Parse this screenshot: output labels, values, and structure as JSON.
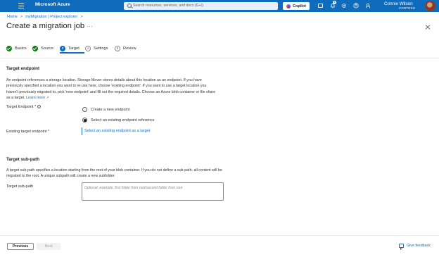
{
  "topbar": {
    "brand": "Microsoft Azure",
    "search_placeholder": "Search resources, services, and docs (G+/)",
    "copilot_label": "Copilot",
    "notification_count": "1",
    "user_name": "Connie Wilson",
    "user_org": "CONTOSO",
    "color": "#0f6cbd"
  },
  "breadcrumb": {
    "items": [
      "Home",
      "myMigration | Project explorer"
    ],
    "separator": ">"
  },
  "page": {
    "title": "Create a migration job",
    "more": "···"
  },
  "steps": [
    {
      "label": "Basics",
      "state": "done",
      "number": "1"
    },
    {
      "label": "Source",
      "state": "done",
      "number": "2"
    },
    {
      "label": "Target",
      "state": "current",
      "number": "3"
    },
    {
      "label": "Settings",
      "state": "todo",
      "number": "4"
    },
    {
      "label": "Review",
      "state": "todo",
      "number": "5"
    }
  ],
  "target_endpoint": {
    "heading": "Target endpoint",
    "description": "An endpoint references a storage location. Storage Mover stores details about this location as an endpoint. If you have previously specified a location you want to re-use here, choose 'existing endpoint'. If you want to use a target location you haven't previously migrated to, pick 'new endpoint' and fill out the required details. Choose an Azure blob container or file share as a target.",
    "learn_more": "Learn more",
    "endpoint_label": "Target Endpoint *",
    "options": [
      {
        "label": "Create a new endpoint",
        "checked": false
      },
      {
        "label": "Select an existing endpoint reference",
        "checked": true
      }
    ],
    "existing_label": "Existing target endpoint *",
    "select_link": "Select an existing endpoint as a target"
  },
  "target_subpath": {
    "heading": "Target sub-path",
    "description": "A target sub-path specifies a location starting from the root of your blob container. If you do not define a sub-path, all content will be migrated to the root. A unique subpath will create a new subfolder.",
    "label": "Target sub-path",
    "placeholder": "Optional, example: first folder from root/second folder from root"
  },
  "footer": {
    "previous": "Previous",
    "next": "Next",
    "feedback": "Give feedback"
  }
}
